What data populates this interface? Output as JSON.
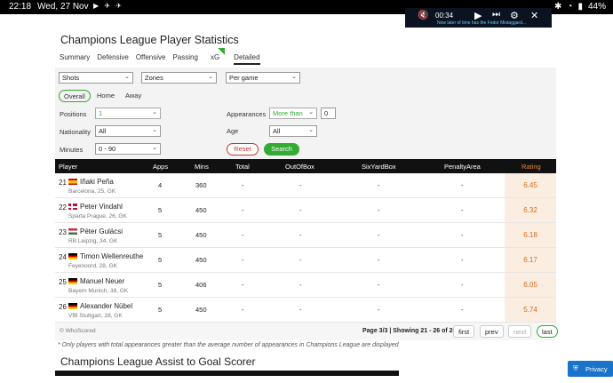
{
  "statusbar": {
    "time": "22:18",
    "date": "Wed, 27 Nov",
    "icons": "▶ ✈ ✈",
    "battery": "44%"
  },
  "video": {
    "time": "00:34",
    "caption": "Now later of time has the Fedor Mistaggard...",
    "icons": [
      "mute-icon",
      "play-icon",
      "skip-icon",
      "gear-icon",
      "close-icon"
    ]
  },
  "page": {
    "title": "Champions League Player Statistics"
  },
  "tabs": [
    "Summary",
    "Defensive",
    "Offensive",
    "Passing",
    "xG",
    "Detailed"
  ],
  "filters": {
    "category": "Shots",
    "subcategory": "Zones",
    "stat_type": "Per game",
    "venue": [
      "Overall",
      "Home",
      "Away"
    ],
    "positions_label": "Positions",
    "positions_value": "1",
    "nationality_label": "Nationality",
    "nationality_value": "All",
    "minutes_label": "Minutes",
    "minutes_value": "0 - 90",
    "appearances_label": "Appearances",
    "appearances_op": "More than",
    "appearances_value": "0",
    "age_label": "Age",
    "age_value": "All",
    "reset": "Reset",
    "search": "Search"
  },
  "table": {
    "headers": [
      "Player",
      "Apps",
      "Mins",
      "Total",
      "OutOfBox",
      "SixYardBox",
      "PenaltyArea",
      "Rating"
    ],
    "rows": [
      {
        "rank": "21",
        "flag": "es",
        "name": "Iñaki Peña",
        "meta": "Barcelona, 25, GK",
        "apps": "4",
        "mins": "360",
        "total": "-",
        "outofbox": "-",
        "sixyard": "-",
        "penalty": "-",
        "rating": "6.45"
      },
      {
        "rank": "22",
        "flag": "dk",
        "name": "Peter Vindahl",
        "meta": "Sparta Prague, 26, GK",
        "apps": "5",
        "mins": "450",
        "total": "-",
        "outofbox": "-",
        "sixyard": "-",
        "penalty": "-",
        "rating": "6.32"
      },
      {
        "rank": "23",
        "flag": "hu",
        "name": "Péter Gulácsi",
        "meta": "RB Leipzig, 34, GK",
        "apps": "5",
        "mins": "450",
        "total": "-",
        "outofbox": "-",
        "sixyard": "-",
        "penalty": "-",
        "rating": "6.18"
      },
      {
        "rank": "24",
        "flag": "de",
        "name": "Timon Wellenreuthe",
        "meta": "Feyenoord, 28, GK",
        "apps": "5",
        "mins": "450",
        "total": "-",
        "outofbox": "-",
        "sixyard": "-",
        "penalty": "-",
        "rating": "6.17"
      },
      {
        "rank": "25",
        "flag": "de",
        "name": "Manuel Neuer",
        "meta": "Bayern Munich, 38, GK",
        "apps": "5",
        "mins": "406",
        "total": "-",
        "outofbox": "-",
        "sixyard": "-",
        "penalty": "-",
        "rating": "6.05"
      },
      {
        "rank": "26",
        "flag": "de",
        "name": "Alexander Nübel",
        "meta": "VfB Stuttgart, 28, GK",
        "apps": "5",
        "mins": "450",
        "total": "-",
        "outofbox": "-",
        "sixyard": "-",
        "penalty": "-",
        "rating": "5.74"
      }
    ]
  },
  "footer": {
    "credit": "© WhoScored",
    "page_info": "Page 3/3 | Showing 21 - 26 of 26",
    "first": "first",
    "prev": "prev",
    "next": "next",
    "last": "last"
  },
  "note": "* Only players with total appearances greater than the average number of appearances in Champions League are displayed",
  "section2": {
    "title": "Champions League Assist to Goal Scorer"
  },
  "privacy": {
    "label": "Privacy"
  },
  "colors": {
    "accent": "#33aa33",
    "rating": "#d2691e",
    "header_bg": "#111111",
    "privacy_bg": "#1a73c9"
  }
}
